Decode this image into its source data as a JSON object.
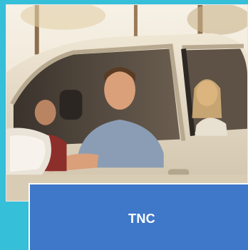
{
  "colors": {
    "background": "#35bfd9",
    "card_fill": "#3f77c9",
    "card_border": "#ffffff"
  },
  "photo": {
    "icon": "people-in-car-photo"
  },
  "card": {
    "title": "TNC"
  }
}
